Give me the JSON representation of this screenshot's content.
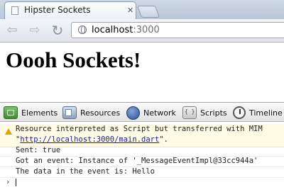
{
  "browser": {
    "tab_title": "Hipster Sockets",
    "tab_close_icon": "close-icon",
    "omnibox": {
      "host": "localhost",
      "port": ":3000"
    }
  },
  "page": {
    "heading": "Oooh Sockets!"
  },
  "devtools": {
    "tabs": [
      {
        "label": "Elements",
        "icon": "elements-icon"
      },
      {
        "label": "Resources",
        "icon": "resources-icon"
      },
      {
        "label": "Network",
        "icon": "network-icon"
      },
      {
        "label": "Scripts",
        "icon": "scripts-icon"
      },
      {
        "label": "Timeline",
        "icon": "timeline-icon"
      }
    ]
  },
  "console": {
    "warning": {
      "text": "Resource interpreted as Script but transferred with MIM",
      "quote_open": "\"",
      "link": "http://localhost:3000/main.dart",
      "quote_close": "\"."
    },
    "messages": [
      "Sent: true",
      "Got an event: Instance of '_MessageEventImpl@33cc944a'",
      "The data in the event is: Hello"
    ],
    "prompt_symbol": "›"
  }
}
